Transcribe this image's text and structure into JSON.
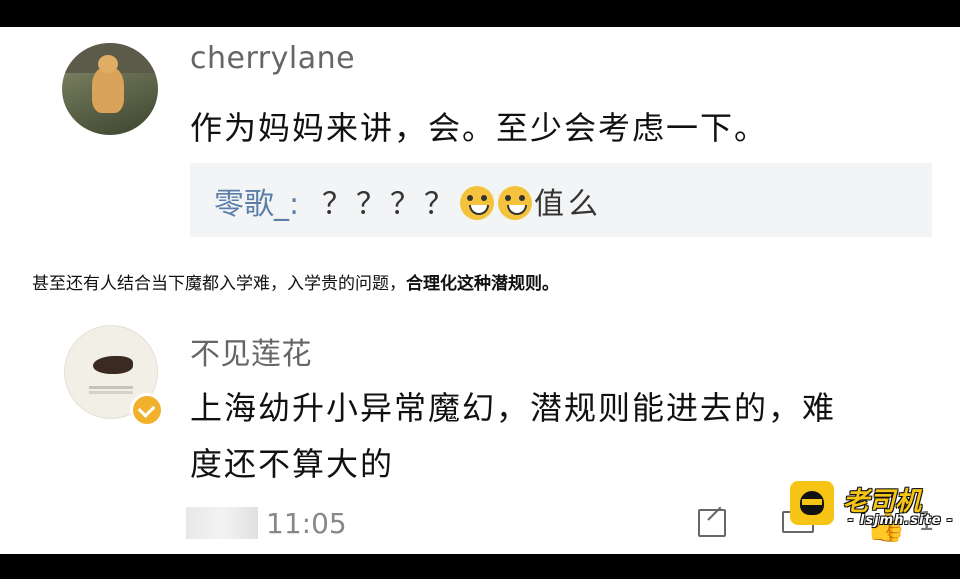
{
  "comment1": {
    "username": "cherrylane",
    "text": "作为妈妈来讲，会。至少会考虑一下。",
    "reply": {
      "name": "零歌_:",
      "text": "？？？？",
      "tail": "值么",
      "emoji": [
        "grinning-face-icon",
        "grinning-face-icon"
      ]
    }
  },
  "note": {
    "text": "甚至还有人结合当下魔都入学难，入学贵的问题，",
    "bold": "合理化这种潜规则。"
  },
  "comment2": {
    "username": "不见莲花",
    "line1": "上海幼升小异常魔幻，潜规则能进去的，难",
    "line2": "度还不算大的",
    "time": "11:05",
    "like_count": "1",
    "actions": [
      "share-icon",
      "comment-icon",
      "like-icon"
    ]
  },
  "watermark": {
    "title": "老司机",
    "site": "- lsjmh.site -"
  },
  "colors": {
    "reply_name": "#5b7fa8",
    "reply_bg": "#f3f4f6",
    "watermark": "#f6c414",
    "verified": "#f2b12d"
  }
}
